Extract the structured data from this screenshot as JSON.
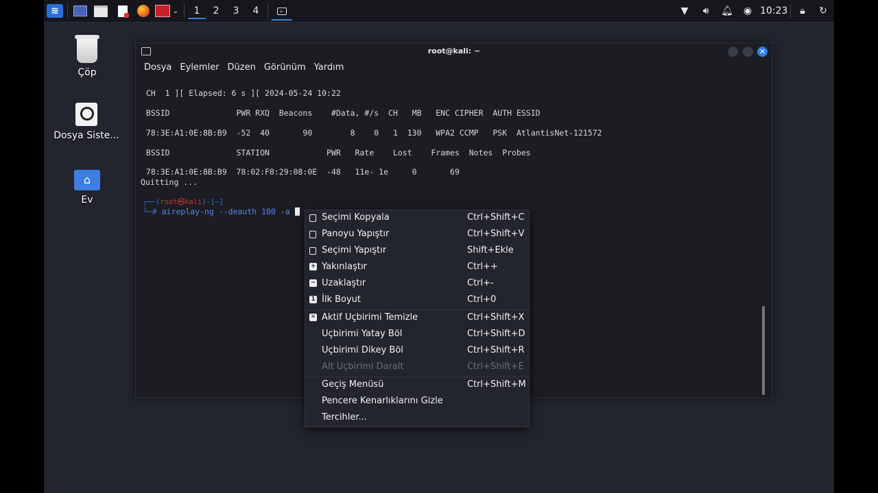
{
  "panel": {
    "menu_icon": "kali-dragon-icon",
    "launchers": [
      "desktop-icon",
      "file-manager-icon",
      "text-editor-icon",
      "firefox-icon",
      "screenshot-tool-icon"
    ],
    "workspaces": [
      "1",
      "2",
      "3",
      "4"
    ],
    "active_workspace": "1",
    "tray_icons": [
      "wifi-icon",
      "volume-icon",
      "notification-bell-icon",
      "power-icon"
    ],
    "clock": "10:23",
    "right_icons": [
      "lock-icon",
      "logout-icon"
    ]
  },
  "desktop": {
    "icons": [
      {
        "label": "Çöp",
        "icon": "trash-icon"
      },
      {
        "label": "Dosya Siste...",
        "icon": "drive-icon"
      },
      {
        "label": "Ev",
        "icon": "home-folder-icon"
      }
    ]
  },
  "terminal": {
    "title": "root@kali: ~",
    "menu": [
      "Dosya",
      "Eylemler",
      "Düzen",
      "Görünüm",
      "Yardım"
    ],
    "lines": {
      "l1": " CH  1 ][ Elapsed: 6 s ][ 2024-05-24 10:22",
      "l2": " BSSID              PWR RXQ  Beacons    #Data, #/s  CH   MB   ENC CIPHER  AUTH ESSID",
      "l3": " 78:3E:A1:0E:8B:B9  -52  40       90        8    0   1  130   WPA2 CCMP   PSK  AtlantisNet-121572",
      "l4": " BSSID              STATION            PWR   Rate    Lost    Frames  Notes  Probes",
      "l5": " 78:3E:A1:0E:8B:B9  78:02:F8:29:08:0E  -48   11e- 1e     0       69",
      "l6": "Quitting ..."
    },
    "prompt_prefix": "┌──(",
    "prompt_user": "root㉿kali",
    "prompt_suffix": ")-[~]",
    "prompt_arrow": "└─#",
    "command": "aireplay-ng --deauth 100 -a"
  },
  "context_menu": {
    "items": [
      {
        "label": "Seçimi Kopyala",
        "shortcut": "Ctrl+Shift+C",
        "icon": "copy-icon"
      },
      {
        "label": "Panoyu Yapıştır",
        "shortcut": "Ctrl+Shift+V",
        "icon": "paste-icon"
      },
      {
        "label": "Seçimi Yapıştır",
        "shortcut": "Shift+Ekle",
        "icon": "paste-selection-icon"
      },
      {
        "label": "Yakınlaştır",
        "shortcut": "Ctrl++",
        "icon": "zoom-in-icon"
      },
      {
        "label": "Uzaklaştır",
        "shortcut": "Ctrl+-",
        "icon": "zoom-out-icon"
      },
      {
        "label": "İlk Boyut",
        "shortcut": "Ctrl+0",
        "icon": "zoom-reset-icon"
      },
      {
        "label": "Aktif Uçbirimi Temizle",
        "shortcut": "Ctrl+Shift+X",
        "icon": "clear-icon"
      },
      {
        "label": "Uçbirimi Yatay Böl",
        "shortcut": "Ctrl+Shift+D"
      },
      {
        "label": "Uçbirimi Dikey Böl",
        "shortcut": "Ctrl+Shift+R"
      },
      {
        "label": "Alt Uçbirimi Daralt",
        "shortcut": "Ctrl+Shift+E",
        "disabled": true
      },
      {
        "label": "Geçiş Menüsü",
        "shortcut": "Ctrl+Shift+M"
      },
      {
        "label": "Pencere Kenarlıklarını Gizle",
        "shortcut": ""
      },
      {
        "label": "Tercihler...",
        "shortcut": ""
      }
    ]
  }
}
